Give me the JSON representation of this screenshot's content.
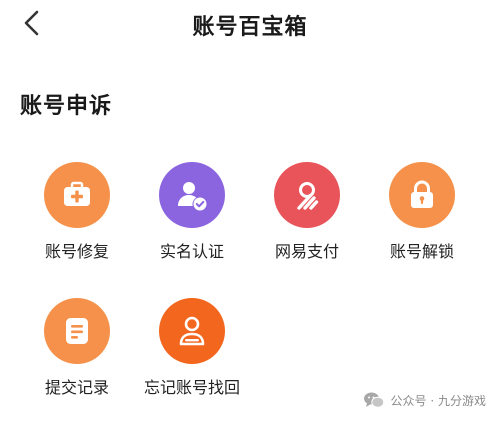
{
  "header": {
    "title": "账号百宝箱",
    "back_icon": "chevron-left-icon"
  },
  "section": {
    "title": "账号申诉"
  },
  "tiles": [
    {
      "label": "账号修复",
      "icon": "medical-kit-icon",
      "color": "#F5914A"
    },
    {
      "label": "实名认证",
      "icon": "verified-user-icon",
      "color": "#8B65E0"
    },
    {
      "label": "网易支付",
      "icon": "netease-pay-icon",
      "color": "#E8545A"
    },
    {
      "label": "账号解锁",
      "icon": "padlock-icon",
      "color": "#F5914A"
    },
    {
      "label": "提交记录",
      "icon": "document-icon",
      "color": "#F5914A"
    },
    {
      "label": "忘记账号找回",
      "icon": "user-retrieve-icon",
      "color": "#F2661E"
    }
  ],
  "watermark": {
    "text": "公众号 · 九分游戏",
    "icon": "wechat-icon"
  }
}
